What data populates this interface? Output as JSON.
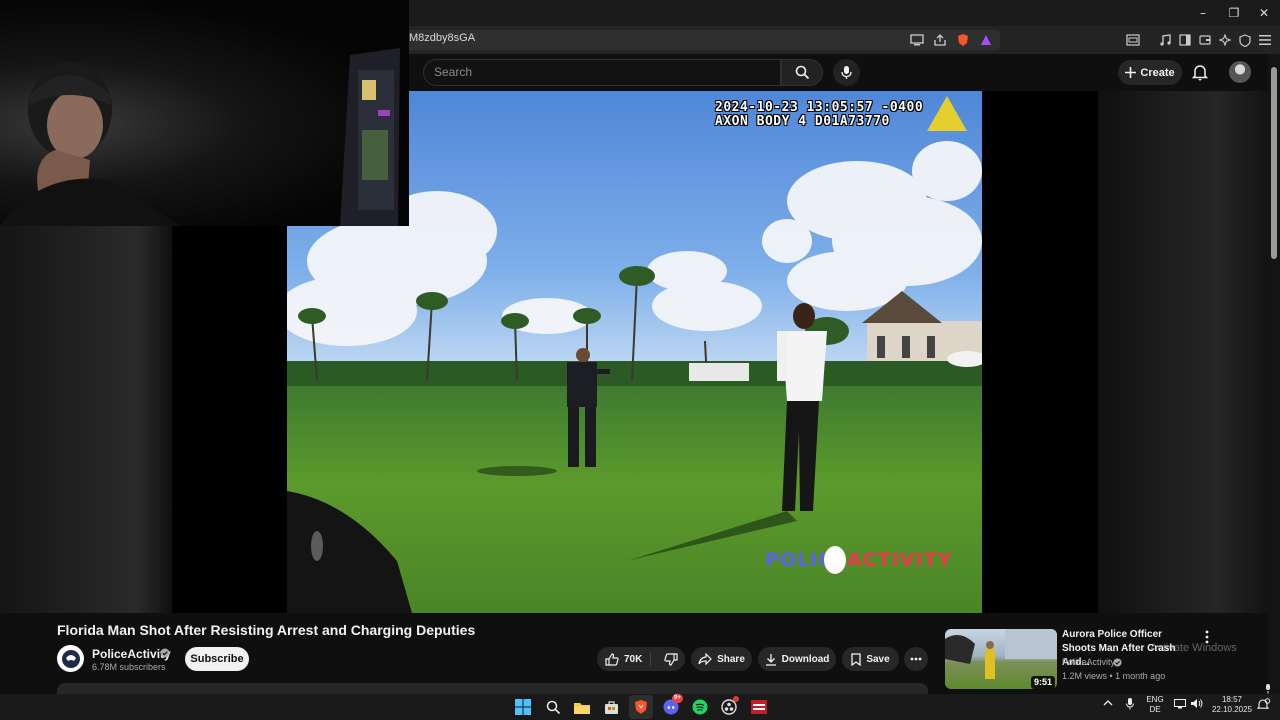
{
  "browser": {
    "url_fragment": "M8zdby8sGA",
    "window_controls": {
      "minimize": "–",
      "maximize": "❐",
      "close": "✕"
    }
  },
  "header": {
    "search_placeholder": "Search",
    "create_label": "Create"
  },
  "video": {
    "osd_line1": "2024-10-23 13:05:57 -0400",
    "osd_line2": "AXON BODY 4 D01A73770",
    "watermark_police": "POLICE",
    "watermark_activity": "ACTIVITY"
  },
  "info": {
    "title": "Florida Man Shot After Resisting Arrest and Charging Deputies",
    "channel_name": "PoliceActivity",
    "subscribers": "6.78M subscribers",
    "subscribe_label": "Subscribe",
    "like_count": "70K",
    "share_label": "Share",
    "download_label": "Download",
    "save_label": "Save"
  },
  "related": {
    "title": "Aurora Police Officer Shoots Man After Crash And...",
    "channel": "PoliceActivity",
    "meta": "1.2M views • 1 month ago",
    "duration": "9:51"
  },
  "overlay": {
    "activate_windows": "Activate Windows"
  },
  "taskbar": {
    "lang_top": "ENG",
    "lang_bottom": "DE",
    "time": "18:57",
    "date": "22.10.2025",
    "discord_badge": "9+"
  },
  "colors": {
    "background": "#0f0f0f",
    "pill": "#272727",
    "brave_orange": "#fb542b",
    "spotify_green": "#1ed760",
    "discord_blurple": "#5865f2"
  }
}
